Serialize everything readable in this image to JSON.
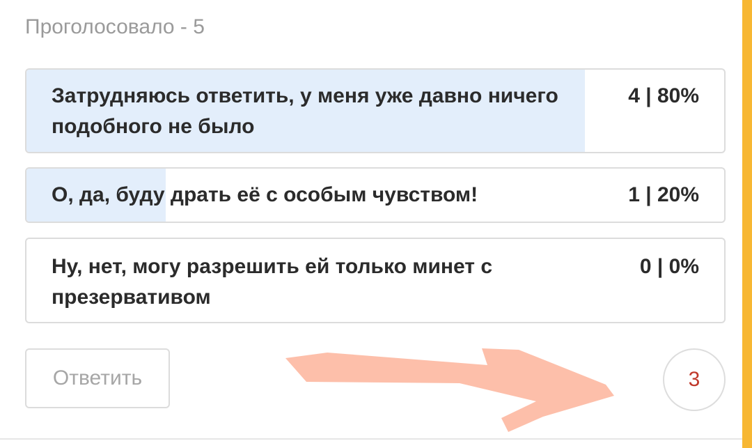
{
  "poll": {
    "vote_count_text": "Проголосовало - 5",
    "options": [
      {
        "label": "Затрудняюсь ответить, у меня уже давно ничего подобного не было",
        "result": "4 | 80%",
        "percent": 80
      },
      {
        "label": "О, да, буду драть её с особым чувством!",
        "result": "1 | 20%",
        "percent": 20
      },
      {
        "label": "Ну, нет, могу разрешить ей только минет с презервативом",
        "result": "0 | 0%",
        "percent": 0
      }
    ]
  },
  "actions": {
    "reply_label": "Ответить",
    "comment_count": "3"
  },
  "colors": {
    "fill": "#e3eefb",
    "accent": "#f7b733",
    "count": "#c0392b",
    "annotation": "#fc9c7c"
  }
}
